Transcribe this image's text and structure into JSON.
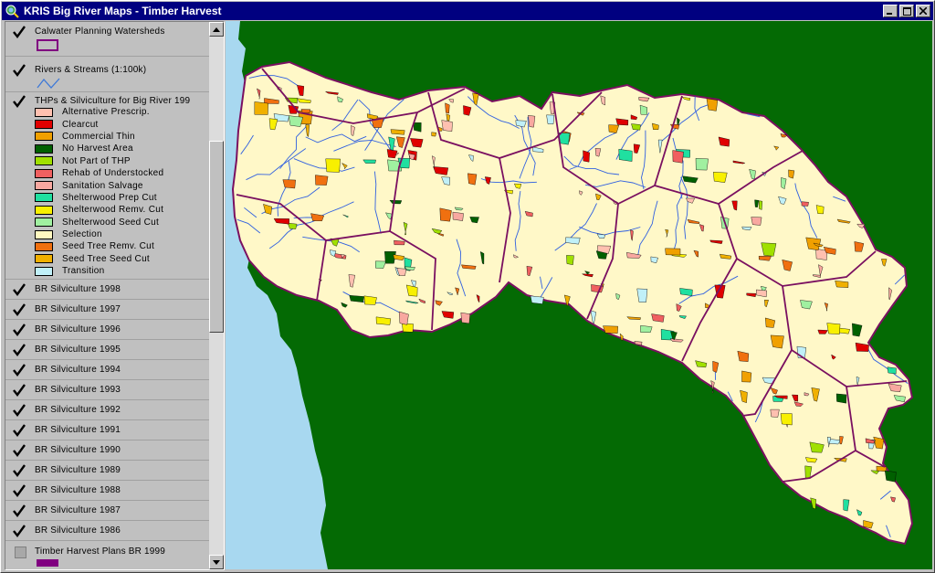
{
  "window": {
    "title": "KRIS Big River Maps - Timber Harvest"
  },
  "toc": {
    "top_themes": [
      {
        "name": "Calwater Planning Watersheds",
        "checked": true,
        "symbol": "polygon-outline",
        "color": "#800080"
      },
      {
        "name": "Rivers & Streams (1:100k)",
        "checked": true,
        "symbol": "line",
        "color": "#3c78d8"
      }
    ],
    "thp_theme": {
      "name": "THPs & Silviculture for Big River 199",
      "checked": true,
      "legend": [
        {
          "label": "Alternative Prescrip.",
          "color": "#ffc0b0"
        },
        {
          "label": "Clearcut",
          "color": "#e00000"
        },
        {
          "label": "Commercial Thin",
          "color": "#f0a000"
        },
        {
          "label": "No Harvest Area",
          "color": "#006000"
        },
        {
          "label": "Not Part of THP",
          "color": "#a0e000"
        },
        {
          "label": "Rehab of Understocked",
          "color": "#f06060"
        },
        {
          "label": "Sanitation Salvage",
          "color": "#f8a8a0"
        },
        {
          "label": "Shelterwood Prep Cut",
          "color": "#20e0a0"
        },
        {
          "label": "Shelterwood Remv. Cut",
          "color": "#f8f000"
        },
        {
          "label": "Shelterwood Seed Cut",
          "color": "#a0f0a0"
        },
        {
          "label": "Selection",
          "color": "#fff8c0"
        },
        {
          "label": "Seed Tree Remv. Cut",
          "color": "#f07010"
        },
        {
          "label": "Seed Tree Seed Cut",
          "color": "#f0b000"
        },
        {
          "label": "Transition",
          "color": "#c0f0f8"
        }
      ]
    },
    "year_themes": [
      {
        "name": "BR Silviculture 1998",
        "checked": true
      },
      {
        "name": "BR Silviculture 1997",
        "checked": true
      },
      {
        "name": "BR Silviculture 1996",
        "checked": true
      },
      {
        "name": "BR Silviculture 1995",
        "checked": true
      },
      {
        "name": "BR Silviculture 1994",
        "checked": true
      },
      {
        "name": "BR Silviculture 1993",
        "checked": true
      },
      {
        "name": "BR Silviculture 1992",
        "checked": true
      },
      {
        "name": "BR Silviculture 1991",
        "checked": true
      },
      {
        "name": "BR Silviculture 1990",
        "checked": true
      },
      {
        "name": "BR Silviculture 1989",
        "checked": true
      },
      {
        "name": "BR Silviculture 1988",
        "checked": true
      },
      {
        "name": "BR Silviculture 1987",
        "checked": true
      },
      {
        "name": "BR Silviculture 1986",
        "checked": true
      }
    ],
    "bottom_theme": {
      "name": "Timber Harvest Plans BR 1999",
      "checked": false,
      "color": "#800080"
    }
  },
  "map": {
    "ocean_color": "#a8d8f0",
    "land_color": "#046a04",
    "watershed_color": "#fff8c8",
    "boundary_color": "#7a1060",
    "stream_color": "#3060e0"
  }
}
